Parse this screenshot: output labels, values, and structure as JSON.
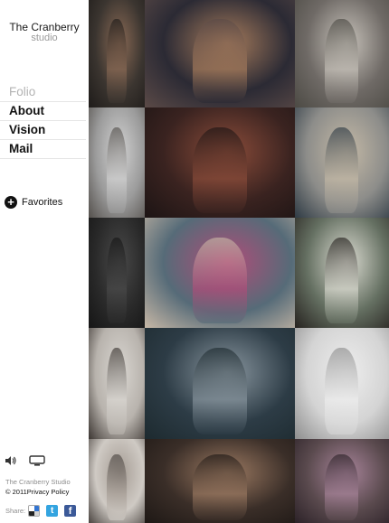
{
  "brand": {
    "name": "The Cranberry",
    "sub": "studio"
  },
  "nav": {
    "items": [
      {
        "label": "Folio",
        "active": true
      },
      {
        "label": "About",
        "active": false
      },
      {
        "label": "Vision",
        "active": false
      },
      {
        "label": "Mail",
        "active": false
      }
    ]
  },
  "favorites": {
    "label": "Favorites"
  },
  "controls": {
    "sound_icon": "speaker-icon",
    "fullscreen_icon": "screen-icon"
  },
  "footer": {
    "studio": "The Cranberry Studio",
    "copyright": "© 2011",
    "privacy": "Privacy Policy",
    "share_label": "Share:",
    "share_icons": [
      "delicious-icon",
      "twitter-icon",
      "facebook-icon"
    ]
  },
  "gallery": {
    "photos": [
      {
        "name": "photo-woman-dark-hair-portrait",
        "colors": [
          "#3b3530",
          "#8a6a55",
          "#1e1b19"
        ]
      },
      {
        "name": "photo-woman-sitting-street-night",
        "colors": [
          "#2b2a34",
          "#a77c5c",
          "#5b4a47"
        ]
      },
      {
        "name": "photo-woman-white-dress-field",
        "colors": [
          "#6f6a66",
          "#c8c3bb",
          "#4c4a44"
        ]
      },
      {
        "name": "photo-man-profile-white-shirt",
        "colors": [
          "#9b9b9b",
          "#d2d2d2",
          "#54504c"
        ]
      },
      {
        "name": "photo-woman-lying-street-night",
        "colors": [
          "#3a2320",
          "#8b4c3a",
          "#1c1414"
        ]
      },
      {
        "name": "photo-woman-shoes-city",
        "colors": [
          "#8d8d8a",
          "#c4b9a6",
          "#2e3a44"
        ]
      },
      {
        "name": "photo-dark-partial-portrait",
        "colors": [
          "#2a2a2a",
          "#4a4a4a",
          "#151515"
        ]
      },
      {
        "name": "photo-couple-pink-dress",
        "colors": [
          "#566b78",
          "#b04c79",
          "#c8b8a6"
        ]
      },
      {
        "name": "photo-woman-lace-blouse",
        "colors": [
          "#657062",
          "#dcdcd2",
          "#26221f"
        ]
      },
      {
        "name": "photo-man-partial-light",
        "colors": [
          "#b8b3ad",
          "#dad7d2",
          "#3c3632"
        ]
      },
      {
        "name": "photo-woman-blue-gown-dusk",
        "colors": [
          "#2d3c46",
          "#8a97a0",
          "#1d2a2f"
        ]
      },
      {
        "name": "photo-dancer-white-studio",
        "colors": [
          "#d4d4d4",
          "#eeeeee",
          "#8e8e8e"
        ]
      },
      {
        "name": "photo-back-portrait-bw",
        "colors": [
          "#cfcac4",
          "#a49b93",
          "#4a4440"
        ]
      },
      {
        "name": "photo-woman-dark-hair-sepia",
        "colors": [
          "#3a2e28",
          "#9c7a62",
          "#1e1815"
        ]
      },
      {
        "name": "photo-woman-blonde-city-night",
        "colors": [
          "#5a4a4e",
          "#a8849a",
          "#2c2228"
        ]
      }
    ]
  }
}
